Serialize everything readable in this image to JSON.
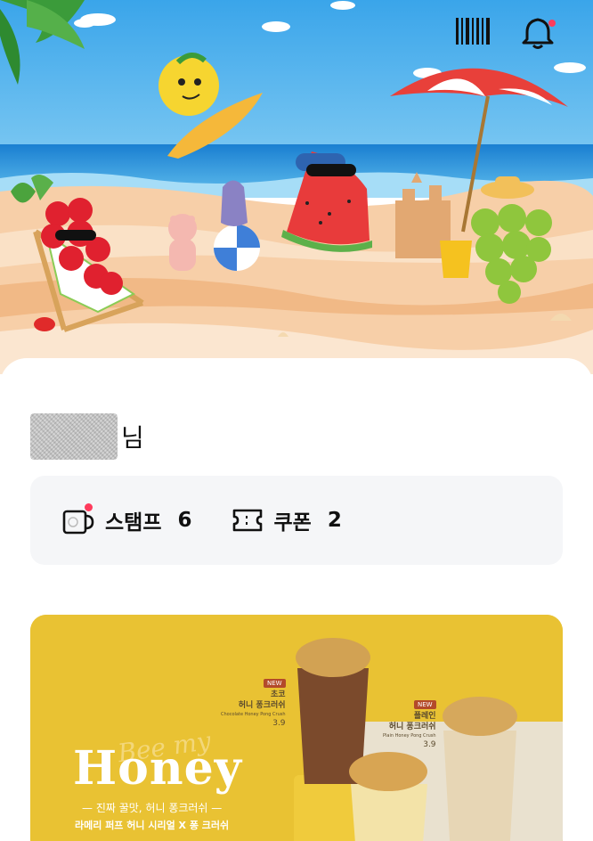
{
  "header": {
    "icons": [
      "barcode-icon",
      "bell-icon"
    ],
    "notification_dot_color": "#ff3b5c"
  },
  "greeting": {
    "suffix": "님"
  },
  "summary": {
    "stamp": {
      "label": "스탬프",
      "count": "6"
    },
    "coupon": {
      "label": "쿠폰",
      "count": "2"
    }
  },
  "promo": {
    "script_text": "Bee my",
    "title": "Honey",
    "subtitle": "— 진짜 꿀맛, 허니 퐁크러쉬 —",
    "subtitle2": "라메리 퍼프 허니 시리얼 X 퐁 크러쉬",
    "products": [
      {
        "badge": "NEW",
        "line1": "초코",
        "line2": "허니 퐁크러쉬",
        "en": "Chocolate Honey Pong Crush",
        "price": "3.9"
      },
      {
        "badge": "NEW",
        "line1": "플레인",
        "line2": "허니 퐁크러쉬",
        "en": "Plain Honey Pong Crush",
        "price": "3.9"
      }
    ],
    "background_color": "#e9c233"
  }
}
